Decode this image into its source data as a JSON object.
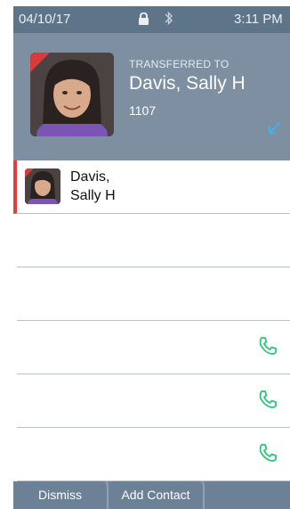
{
  "status": {
    "date": "04/10/17",
    "time": "3:11 PM",
    "lock_icon": "lock-icon",
    "bluetooth_icon": "bluetooth-icon"
  },
  "header": {
    "label": "TRANSFERRED TO",
    "name": "Davis, Sally H",
    "extension": "1107",
    "arrow_icon": "transfer-arrow-icon"
  },
  "contacts": [
    {
      "name_line1": "Davis,",
      "name_line2": "Sally H",
      "active": true
    }
  ],
  "empty_rows": 5,
  "bottom": {
    "dismiss": "Dismiss",
    "add_contact": "Add Contact"
  },
  "colors": {
    "header_bg": "#7d8fa1",
    "status_bg": "#5e7488",
    "accent_red": "#e0403a",
    "phone_green": "#2ec47a",
    "arrow_blue": "#3fb2e8"
  }
}
